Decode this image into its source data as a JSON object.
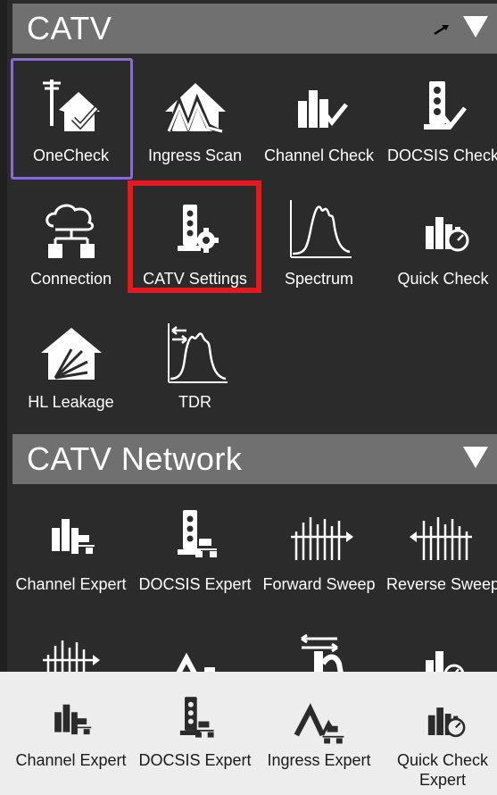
{
  "sections": [
    {
      "title": "CATV",
      "tiles": [
        {
          "label": "OneCheck",
          "icon": "house-antenna-check-icon"
        },
        {
          "label": "Ingress Scan",
          "icon": "ingress-scan-icon"
        },
        {
          "label": "Channel Check",
          "icon": "channel-check-icon"
        },
        {
          "label": "DOCSIS Check",
          "icon": "docsis-check-icon"
        },
        {
          "label": "Connection",
          "icon": "cloud-network-icon"
        },
        {
          "label": "CATV Settings",
          "icon": "settings-gear-icon"
        },
        {
          "label": "Spectrum",
          "icon": "spectrum-icon"
        },
        {
          "label": "Quick Check",
          "icon": "quick-check-icon"
        },
        {
          "label": "HL Leakage",
          "icon": "house-leakage-icon"
        },
        {
          "label": "TDR",
          "icon": "tdr-icon"
        }
      ]
    },
    {
      "title": "CATV Network",
      "tiles": [
        {
          "label": "Channel Expert",
          "icon": "channel-expert-icon"
        },
        {
          "label": "DOCSIS Expert",
          "icon": "docsis-expert-icon"
        },
        {
          "label": "Forward Sweep",
          "icon": "forward-sweep-icon"
        },
        {
          "label": "Reverse Sweep",
          "icon": "reverse-sweep-icon"
        }
      ]
    }
  ],
  "bottom_bar": {
    "tiles": [
      {
        "label": "Channel Expert",
        "icon": "channel-expert-icon"
      },
      {
        "label": "DOCSIS Expert",
        "icon": "docsis-expert-icon"
      },
      {
        "label": "Ingress Expert",
        "icon": "ingress-expert-icon"
      },
      {
        "label": "Quick Check Expert",
        "icon": "quick-check-icon"
      }
    ]
  },
  "colors": {
    "header_bg": "#707070",
    "selection_purple": "#8a6bd4",
    "selection_red": "#e8171c",
    "bottom_bar_bg": "#ededed"
  }
}
